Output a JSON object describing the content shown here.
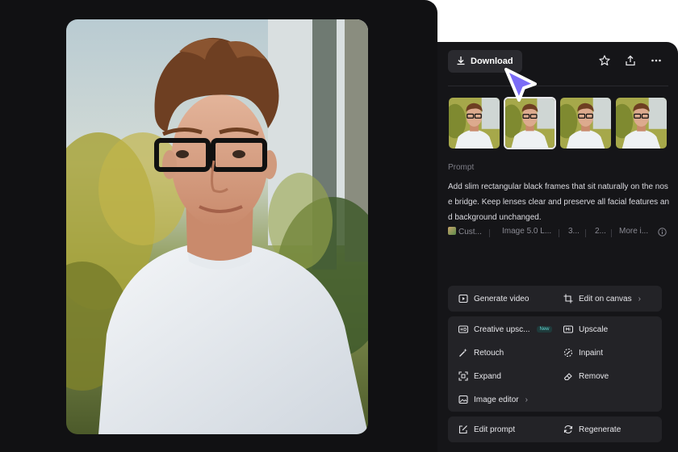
{
  "toolbar": {
    "download_label": "Download",
    "icons": [
      "download-icon",
      "star-icon",
      "share-icon",
      "more-icon"
    ]
  },
  "thumbnails": {
    "count": 4,
    "selected_index": 1
  },
  "prompt": {
    "label": "Prompt",
    "text": "Add slim rectangular black frames that sit naturally on the nose bridge. Keep lenses clear and preserve all facial features and background unchanged."
  },
  "meta": {
    "items": [
      "Cust...",
      "Image 5.0 L...",
      "3...",
      "2...",
      "More i..."
    ],
    "info_icon": "info-icon"
  },
  "actions": {
    "generate_video": "Generate video",
    "edit_on_canvas": "Edit on canvas",
    "creative_upscale": "Creative upsc...",
    "new_badge": "New",
    "upscale": "Upscale",
    "retouch": "Retouch",
    "inpaint": "Inpaint",
    "expand": "Expand",
    "remove": "Remove",
    "image_editor": "Image editor",
    "edit_prompt": "Edit prompt",
    "regenerate": "Regenerate"
  },
  "colors": {
    "stage_bg": "#111113",
    "panel_bg": "#151518",
    "button_bg": "#232327",
    "cursor": "#7b6cf6"
  }
}
